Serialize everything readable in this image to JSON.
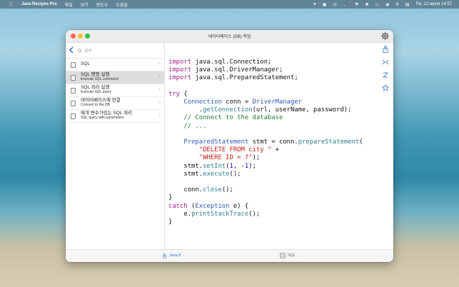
{
  "menubar": {
    "app_name": "Java Recipes Pro",
    "menus": [
      "파일",
      "보기",
      "윈도우",
      "도움말"
    ],
    "date_time": "Пн, 12 июля  14:57"
  },
  "window": {
    "title": "데이터베이스 (DB) 작업",
    "search_placeholder": "검색"
  },
  "sidebar": {
    "items": [
      {
        "title": "SQL",
        "subtitle": ""
      },
      {
        "title": "SQL 명령 실행",
        "subtitle": "Execute SQL command"
      },
      {
        "title": "SQL 쿼리 실행",
        "subtitle": "Execute SQL query"
      },
      {
        "title": "데이터베이스에 연결",
        "subtitle": "Connect to the DB"
      },
      {
        "title": "매개 변수가있는 SQL 쿼리",
        "subtitle": "SQL query with parameters"
      }
    ]
  },
  "code": [
    "import java.sql.Connection;",
    "import java.sql.DriverManager;",
    "import java.sql.PreparedStatement;",
    "",
    "try {",
    "    Connection conn = DriverManager",
    "        .getConnection(url, userName, password);",
    "    // Connect to the database",
    "    // ...",
    "",
    "    PreparedStatement stmt = conn.prepareStatement(",
    "        \"DELETE FROM city \" +",
    "        \"WHERE ID = ?\");",
    "    stmt.setInt(1, -1);",
    "    stmt.execute();",
    "",
    "    conn.close();",
    "}",
    "catch (Exception e) {",
    "    e.printStackTrace();",
    "}"
  ],
  "bottom_tabs": {
    "java": "Java 8",
    "sql": "SQL"
  },
  "colors": {
    "keyword": "#a0208e",
    "type": "#2a58b8",
    "method": "#2f7d90",
    "string": "#c41a16",
    "comment": "#237b37",
    "accent": "#2f6fd6"
  }
}
